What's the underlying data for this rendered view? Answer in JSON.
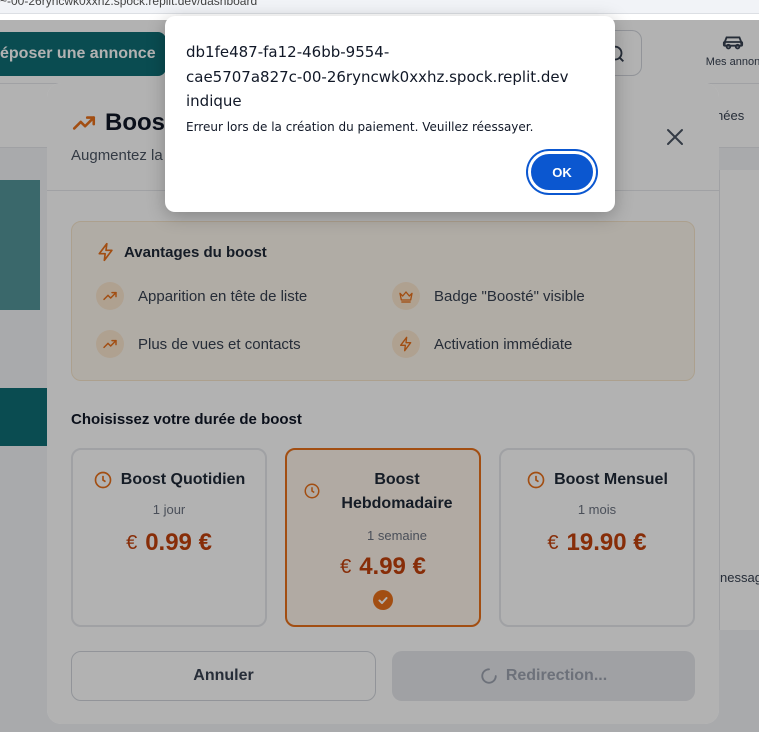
{
  "browser": {
    "url_fragment": "~-00-26ryncwk0xxhz.spock.replit.dev/dashboard"
  },
  "header": {
    "post_button": "époser une annonce",
    "my_ads": "Mes annon"
  },
  "background": {
    "tab_right": "hées",
    "right_card_text": "nessag"
  },
  "modal": {
    "title": "Boost",
    "subtitle": "Augmentez la",
    "advantages": {
      "title": "Avantages du boost",
      "items": [
        {
          "label": "Apparition en tête de liste",
          "icon": "trending-up-icon"
        },
        {
          "label": "Badge \"Boosté\" visible",
          "icon": "crown-icon"
        },
        {
          "label": "Plus de vues et contacts",
          "icon": "trending-up-icon"
        },
        {
          "label": "Activation immédiate",
          "icon": "zap-icon"
        }
      ]
    },
    "choose_title": "Choisissez votre durée de boost",
    "plans": [
      {
        "name": "Boost Quotidien",
        "duration": "1 jour",
        "currency": "€",
        "price": "0.99 €",
        "selected": false
      },
      {
        "name_line1": "Boost",
        "name_line2": "Hebdomadaire",
        "duration": "1 semaine",
        "currency": "€",
        "price": "4.99 €",
        "selected": true
      },
      {
        "name": "Boost Mensuel",
        "duration": "1 mois",
        "currency": "€",
        "price": "19.90 €",
        "selected": false
      }
    ],
    "cancel_label": "Annuler",
    "redirect_label": "Redirection..."
  },
  "alert": {
    "origin_line1": "db1fe487-fa12-46bb-9554-",
    "origin_line2": "cae5707a827c-00-26ryncwk0xxhz.spock.replit.dev",
    "origin_line3": "indique",
    "message": "Erreur lors de la création du paiement. Veuillez réessayer.",
    "ok_label": "OK"
  },
  "colors": {
    "accent_orange": "#e8701b",
    "price_orange": "#c2410c",
    "teal": "#0f6e74",
    "ok_blue": "#0b57d0"
  }
}
